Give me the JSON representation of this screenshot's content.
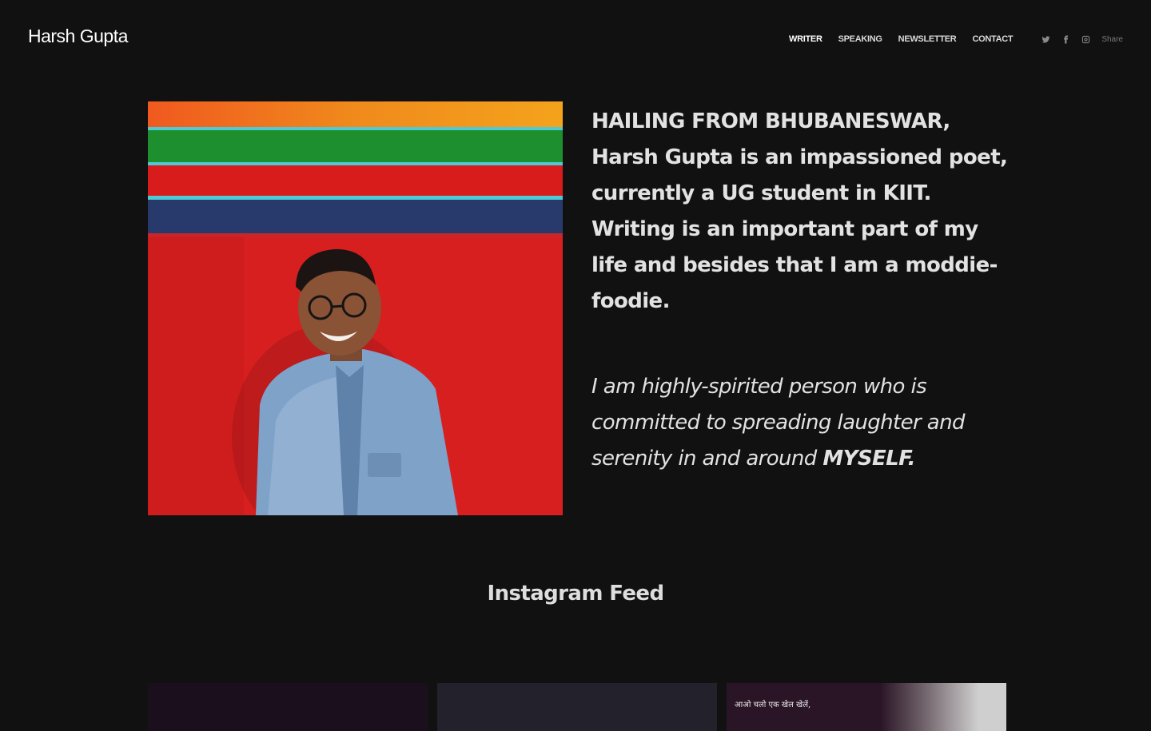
{
  "header": {
    "site_title": "Harsh Gupta",
    "nav": [
      {
        "label": "WRITER",
        "active": true
      },
      {
        "label": "SPEAKING",
        "active": false
      },
      {
        "label": "NEWSLETTER",
        "active": false
      },
      {
        "label": "CONTACT",
        "active": false
      }
    ],
    "social": [
      {
        "icon": "twitter-icon"
      },
      {
        "icon": "facebook-icon"
      },
      {
        "icon": "instagram-icon"
      }
    ],
    "share_label": "Share"
  },
  "bio": {
    "lead": "HAILING FROM BHUBANESWAR,",
    "para1": "Harsh Gupta is an impassioned poet, currently a UG student in KIIT. Writing is an important part of my life and besides that I am a moddie-foodie.",
    "para2": "I am highly-spirited person who is committed to spreading laughter and serenity in and around",
    "para2_emph": "MYSELF."
  },
  "instagram": {
    "title": "Instagram Feed",
    "post3_caption": "आओ चलो एक खेल खेलें,"
  },
  "colors": {
    "background": "#111111",
    "text": "#e2e2e2",
    "portrait_wall": "#d81f1f"
  }
}
